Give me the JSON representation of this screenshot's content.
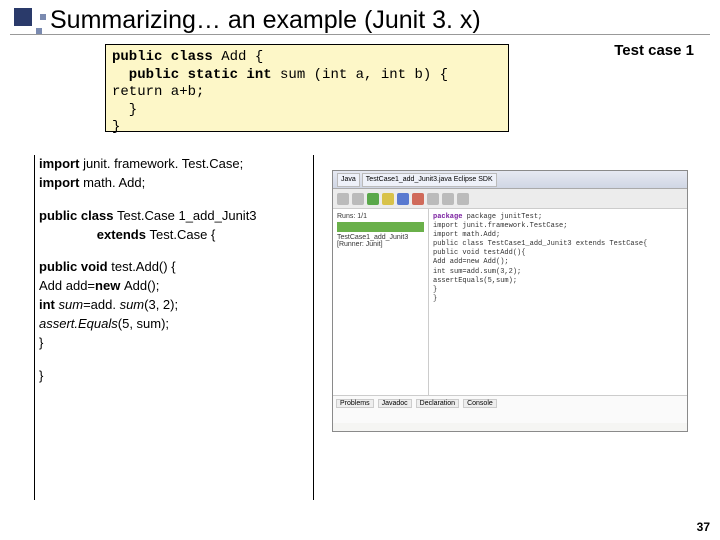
{
  "title": "Summarizing… an example (Junit 3. x)",
  "label_testcase": "Test case 1",
  "codebox": {
    "l1a": "public class ",
    "l1b": "Add {",
    "l2a": "  public static int ",
    "l2b": "sum (int a, int b) {",
    "l3": "return a+b;",
    "l4": "  }",
    "l5": "}"
  },
  "left": {
    "i1a": "import ",
    "i1b": "junit. framework. Test.Case;",
    "i2a": "import ",
    "i2b": "math. Add;",
    "c1a": "public class ",
    "c1b": "Test.Case 1_add_Junit3",
    "c2a": "extends ",
    "c2b": "Test.Case {",
    "m1a": "public void ",
    "m1b": "test.Add() {",
    "m2a": "  Add add=",
    "m2kw": "new ",
    "m2b": "Add();",
    "m3a": "  int ",
    "m3ital": "sum",
    "m3b": "=add. ",
    "m3ital2": "sum",
    "m3c": "(3, 2);",
    "m4ital": "  assert.Equals",
    "m4b": "(5, sum);",
    "m5": "  }",
    "end": "}"
  },
  "page_num": "37",
  "ide": {
    "tab1": "Java",
    "tab2": "TestCase1_add_Junit3.java  Eclipse SDK",
    "left_header": "Runs: 1/1",
    "left_sub": "TestCase1_add_Junit3 [Runner: Junit]",
    "r1": "package junitTest;",
    "r2": "import junit.framework.TestCase;",
    "r3": "import math.Add;",
    "r4": "public class TestCase1_add_Junit3 extends TestCase{",
    "r5": "  public void testAdd(){",
    "r6": "    Add add=new Add();",
    "r7": "    int sum=add.sum(3,2);",
    "r8": "    assertEquals(5,sum);",
    "r9": "  }",
    "r10": "}",
    "btab1": "Problems",
    "btab2": "Javadoc",
    "btab3": "Declaration",
    "btab4": "Console"
  }
}
